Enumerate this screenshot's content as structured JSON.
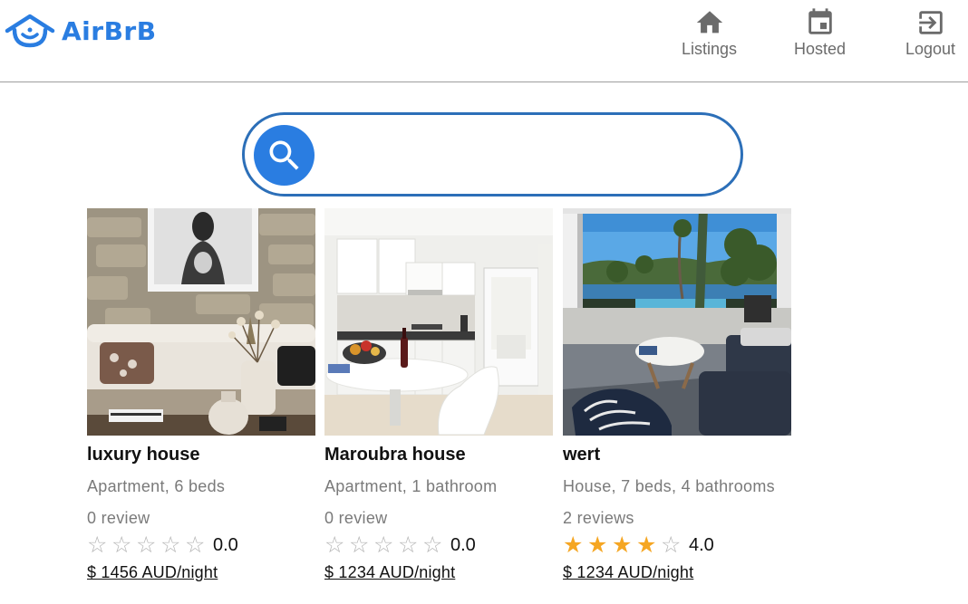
{
  "brand": {
    "name": "AirBrB",
    "color": "#2a7de1"
  },
  "nav": [
    {
      "label": "Listings",
      "icon": "home-icon"
    },
    {
      "label": "Hosted",
      "icon": "calendar-icon"
    },
    {
      "label": "Logout",
      "icon": "logout-icon"
    }
  ],
  "search": {
    "placeholder": "",
    "value": "",
    "icon": "search-icon"
  },
  "listings": [
    {
      "title": "luxury house",
      "subtitle": "Apartment, 6 beds",
      "reviews": "0 review",
      "stars": 0,
      "rating": "0.0",
      "price": "$ 1456 AUD/night",
      "image": "living-room-photo"
    },
    {
      "title": "Maroubra house",
      "subtitle": "Apartment, 1 bathroom",
      "reviews": "0 review",
      "stars": 0,
      "rating": "0.0",
      "price": "$ 1234 AUD/night",
      "image": "kitchen-photo"
    },
    {
      "title": "wert",
      "subtitle": "House, 7 beds, 4 bathrooms",
      "reviews": "2 reviews",
      "stars": 4,
      "rating": "4.0",
      "price": "$ 1234 AUD/night",
      "image": "pool-view-photo"
    }
  ],
  "colors": {
    "star_filled": "#f5a623",
    "star_empty": "#b5b5b5",
    "search_border": "#2c6fb8",
    "nav_icon": "#6b6b6b"
  }
}
